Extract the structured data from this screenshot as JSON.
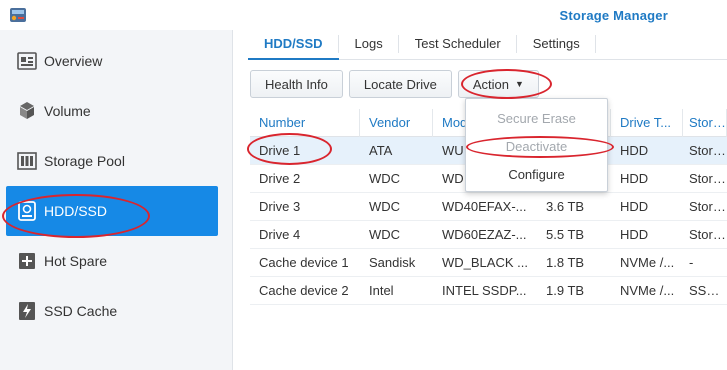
{
  "window": {
    "title": "Storage Manager"
  },
  "sidebar": {
    "items": [
      {
        "label": "Overview",
        "icon": "overview-icon"
      },
      {
        "label": "Volume",
        "icon": "volume-icon"
      },
      {
        "label": "Storage Pool",
        "icon": "storage-pool-icon"
      },
      {
        "label": "HDD/SSD",
        "icon": "hdd-icon",
        "active": true
      },
      {
        "label": "Hot Spare",
        "icon": "hot-spare-icon"
      },
      {
        "label": "SSD Cache",
        "icon": "ssd-cache-icon"
      }
    ]
  },
  "tabs": [
    "HDD/SSD",
    "Logs",
    "Test Scheduler",
    "Settings"
  ],
  "toolbar": {
    "health_info": "Health Info",
    "locate_drive": "Locate Drive",
    "action": "Action"
  },
  "action_menu": {
    "items": [
      {
        "label": "Secure Erase",
        "enabled": false
      },
      {
        "label": "Deactivate",
        "enabled": false
      },
      {
        "label": "Configure",
        "enabled": true
      }
    ]
  },
  "table": {
    "columns": [
      "Number",
      "Vendor",
      "Model",
      "",
      "Drive T...",
      "Storag"
    ],
    "rows": [
      [
        "Drive 1",
        "ATA",
        "WU",
        "",
        "HDD",
        "Storag"
      ],
      [
        "Drive 2",
        "WDC",
        "WD",
        "",
        "HDD",
        "Storag"
      ],
      [
        "Drive 3",
        "WDC",
        "WD40EFAX-...",
        "3.6 TB",
        "HDD",
        "Storag"
      ],
      [
        "Drive 4",
        "WDC",
        "WD60EZAZ-...",
        "5.5 TB",
        "HDD",
        "Storag"
      ],
      [
        "Cache device 1",
        "Sandisk",
        "WD_BLACK ...",
        "1.8 TB",
        "NVMe /...",
        "-"
      ],
      [
        "Cache device 2",
        "Intel",
        "INTEL SSDP...",
        "1.9 TB",
        "NVMe /...",
        "SSD C"
      ]
    ]
  },
  "colors": {
    "accent": "#1f7ac4",
    "active_bg": "#1689e6",
    "annotation": "#d9252e"
  }
}
